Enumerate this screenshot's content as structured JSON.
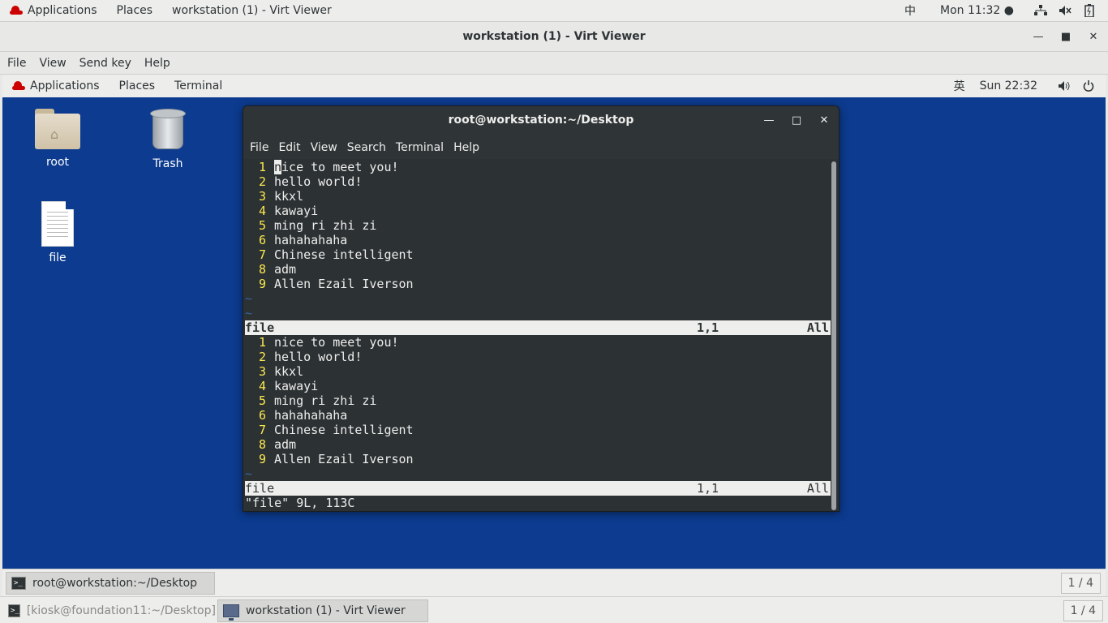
{
  "host_topbar": {
    "applications": "Applications",
    "places": "Places",
    "window_title": "workstation (1) - Virt Viewer",
    "input_method": "中",
    "clock": "Mon 11:32 ●"
  },
  "vv_window": {
    "title": "workstation (1) - Virt Viewer",
    "menu": [
      "File",
      "View",
      "Send key",
      "Help"
    ]
  },
  "guest_topbar": {
    "applications": "Applications",
    "places": "Places",
    "terminal": "Terminal",
    "input_method": "英",
    "clock": "Sun 22:32"
  },
  "desktop_icons": {
    "root": "root",
    "trash": "Trash",
    "file": "file"
  },
  "terminal": {
    "title": "root@workstation:~/Desktop",
    "menu": [
      "File",
      "Edit",
      "View",
      "Search",
      "Terminal",
      "Help"
    ],
    "top_pane": {
      "lines": [
        "nice to meet you!",
        "hello world!",
        "kkxl",
        "kawayi",
        "ming ri zhi zi",
        "hahahahaha",
        "Chinese intelligent",
        "adm",
        "Allen Ezail Iverson"
      ],
      "status_file": "file",
      "status_pos": "1,1",
      "status_all": "All"
    },
    "bottom_pane": {
      "lines": [
        "nice to meet you!",
        "hello world!",
        "kkxl",
        "kawayi",
        "ming ri zhi zi",
        "hahahahaha",
        "Chinese intelligent",
        "adm",
        "Allen Ezail Iverson"
      ],
      "status_file": "file",
      "status_pos": "1,1",
      "status_all": "All"
    },
    "message": "\"file\" 9L, 113C"
  },
  "guest_bottom": {
    "task": "root@workstation:~/Desktop",
    "workspace": "1 / 4"
  },
  "host_bottom": {
    "task1": "[kiosk@foundation11:~/Desktop]",
    "task2": "workstation (1) - Virt Viewer",
    "workspace": "1 / 4"
  }
}
